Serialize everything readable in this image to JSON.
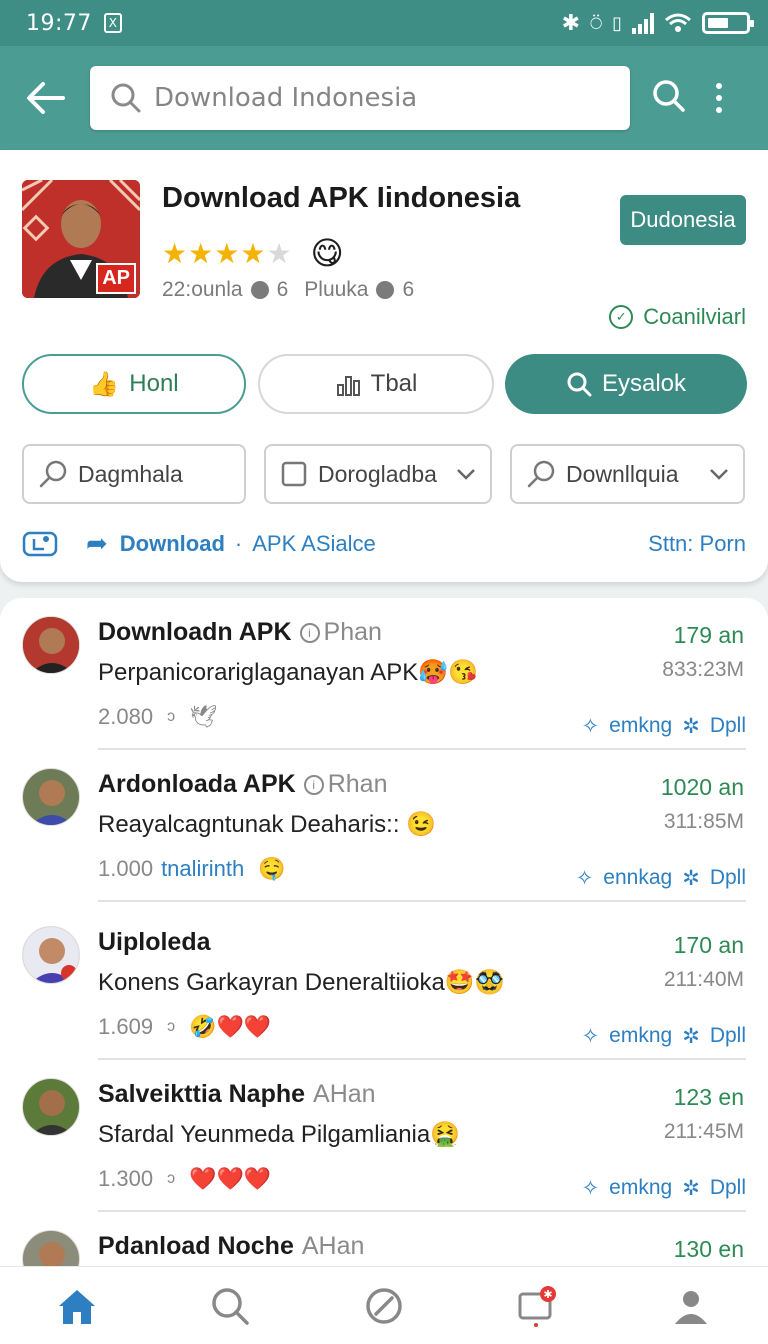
{
  "statusbar": {
    "time": "19:77",
    "notif_badge": "X"
  },
  "search": {
    "placeholder": "Download Indonesia"
  },
  "app": {
    "title": "Download APK Iindonesia",
    "rating": 4,
    "rating_max": 5,
    "meta1": "22:ounla",
    "meta2": "6",
    "meta3": "Pluuka",
    "meta4": "6",
    "region_button": "Dudonesia",
    "compat": "Coanilviarl",
    "icon_badge": "AP"
  },
  "actions": {
    "pill1": "Honl",
    "pill2": "Tbal",
    "pill3": "Eysalok"
  },
  "filters": {
    "f1": "Dagmhala",
    "f2": "Dorogladba",
    "f3": "Downllquia"
  },
  "tagrow": {
    "download": "Download",
    "dot": "·",
    "apk": "APK ASialce",
    "sort": "Sttn: Porn"
  },
  "posts": [
    {
      "name": "Downloadn APK",
      "tag": "Phan",
      "msg": "Perpanicorariglaganayan APK",
      "emoji": "🥵😘",
      "count": "2.080",
      "extra": "",
      "extra_emoji": "🕊",
      "time": "179 an",
      "size": "833:23M",
      "act1": "emkng",
      "act2": "Dpll"
    },
    {
      "name": "Ardonloada APK",
      "tag": "Rhan",
      "msg": "Reayalcagntunak Deaharis::",
      "emoji": "😉",
      "count": "1.000",
      "extra": "tnalirinth",
      "extra_emoji": "🤤",
      "time": "1020 an",
      "size": "311:85M",
      "act1": "ennkag",
      "act2": "Dpll"
    },
    {
      "name": "Uiploleda",
      "tag": "",
      "msg": "Konens Garkayran Deneraltiioka",
      "emoji": "🤩🥸",
      "count": "1.609",
      "extra": "",
      "extra_emoji": "🤣❤️❤️",
      "time": "170 an",
      "size": "211:40M",
      "act1": "emkng",
      "act2": "Dpll"
    },
    {
      "name": "Salveikttia Naphe",
      "tag": "AHan",
      "msg": "Sfardal Yeunmeda Pilgamliania",
      "emoji": "🤮",
      "count": "1.300",
      "extra": "",
      "extra_emoji": "❤️❤️❤️",
      "time": "123 en",
      "size": "211:45M",
      "act1": "emkng",
      "act2": "Dpll"
    },
    {
      "name": "Pdanload Noche",
      "tag": "AHan",
      "msg": "",
      "emoji": "",
      "count": "",
      "extra": "",
      "extra_emoji": "",
      "time": "130 en",
      "size": "",
      "act1": "",
      "act2": ""
    }
  ],
  "colors": {
    "accent": "#4b9d94",
    "accent_dark": "#3c8c83",
    "link": "#2d7fc1",
    "green_text": "#2e8a55"
  },
  "icons": [
    "back-arrow-icon",
    "search-icon",
    "more-vert-icon",
    "thumbs-up-icon",
    "chart-icon",
    "search-icon",
    "search-icon",
    "square-icon",
    "chevron-down-icon",
    "info-icon",
    "home-icon",
    "compass-icon",
    "notification-icon",
    "profile-icon"
  ]
}
